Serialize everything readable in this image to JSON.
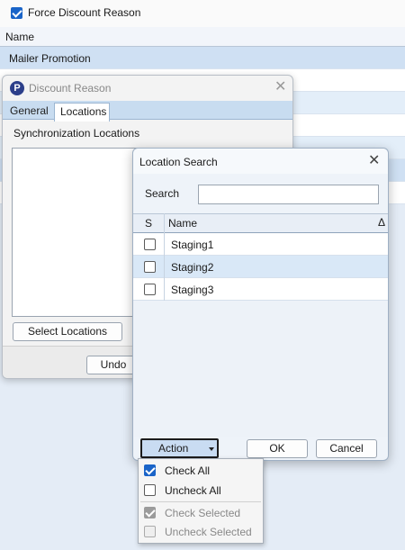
{
  "background": {
    "force_checkbox_label": "Force Discount Reason",
    "force_checkbox_checked": true,
    "column_header": "Name",
    "rows": [
      "Mailer Promotion",
      "",
      "",
      "",
      "",
      ""
    ]
  },
  "discount_dialog": {
    "title": "Discount Reason",
    "tabs": [
      "General",
      "Locations"
    ],
    "active_tab": "Locations",
    "section_label": "Synchronization Locations",
    "select_button": "Select Locations",
    "undo_button": "Undo"
  },
  "search_dialog": {
    "title": "Location Search",
    "search_label": "Search",
    "search_value": "",
    "columns": {
      "select": "S",
      "name": "Name",
      "sort_indicator": "Δ"
    },
    "rows": [
      {
        "name": "Staging1",
        "checked": false
      },
      {
        "name": "Staging2",
        "checked": false
      },
      {
        "name": "Staging3",
        "checked": false
      }
    ],
    "action_button": "Action",
    "ok_button": "OK",
    "cancel_button": "Cancel"
  },
  "action_menu": {
    "items": [
      {
        "label": "Check All",
        "checked": true,
        "enabled": true
      },
      {
        "label": "Uncheck All",
        "checked": false,
        "enabled": true
      },
      {
        "label": "Check Selected",
        "checked": true,
        "enabled": false
      },
      {
        "label": "Uncheck Selected",
        "checked": false,
        "enabled": false
      }
    ]
  },
  "colors": {
    "accent": "#1a64c8",
    "selected_row": "#cfe0f3",
    "alt_row": "#e3eef9",
    "tabstrip": "#c8dcf0"
  },
  "icons": {
    "app_icon": "p-logo-icon",
    "close": "close-icon",
    "dropdown": "caret-down-icon"
  }
}
